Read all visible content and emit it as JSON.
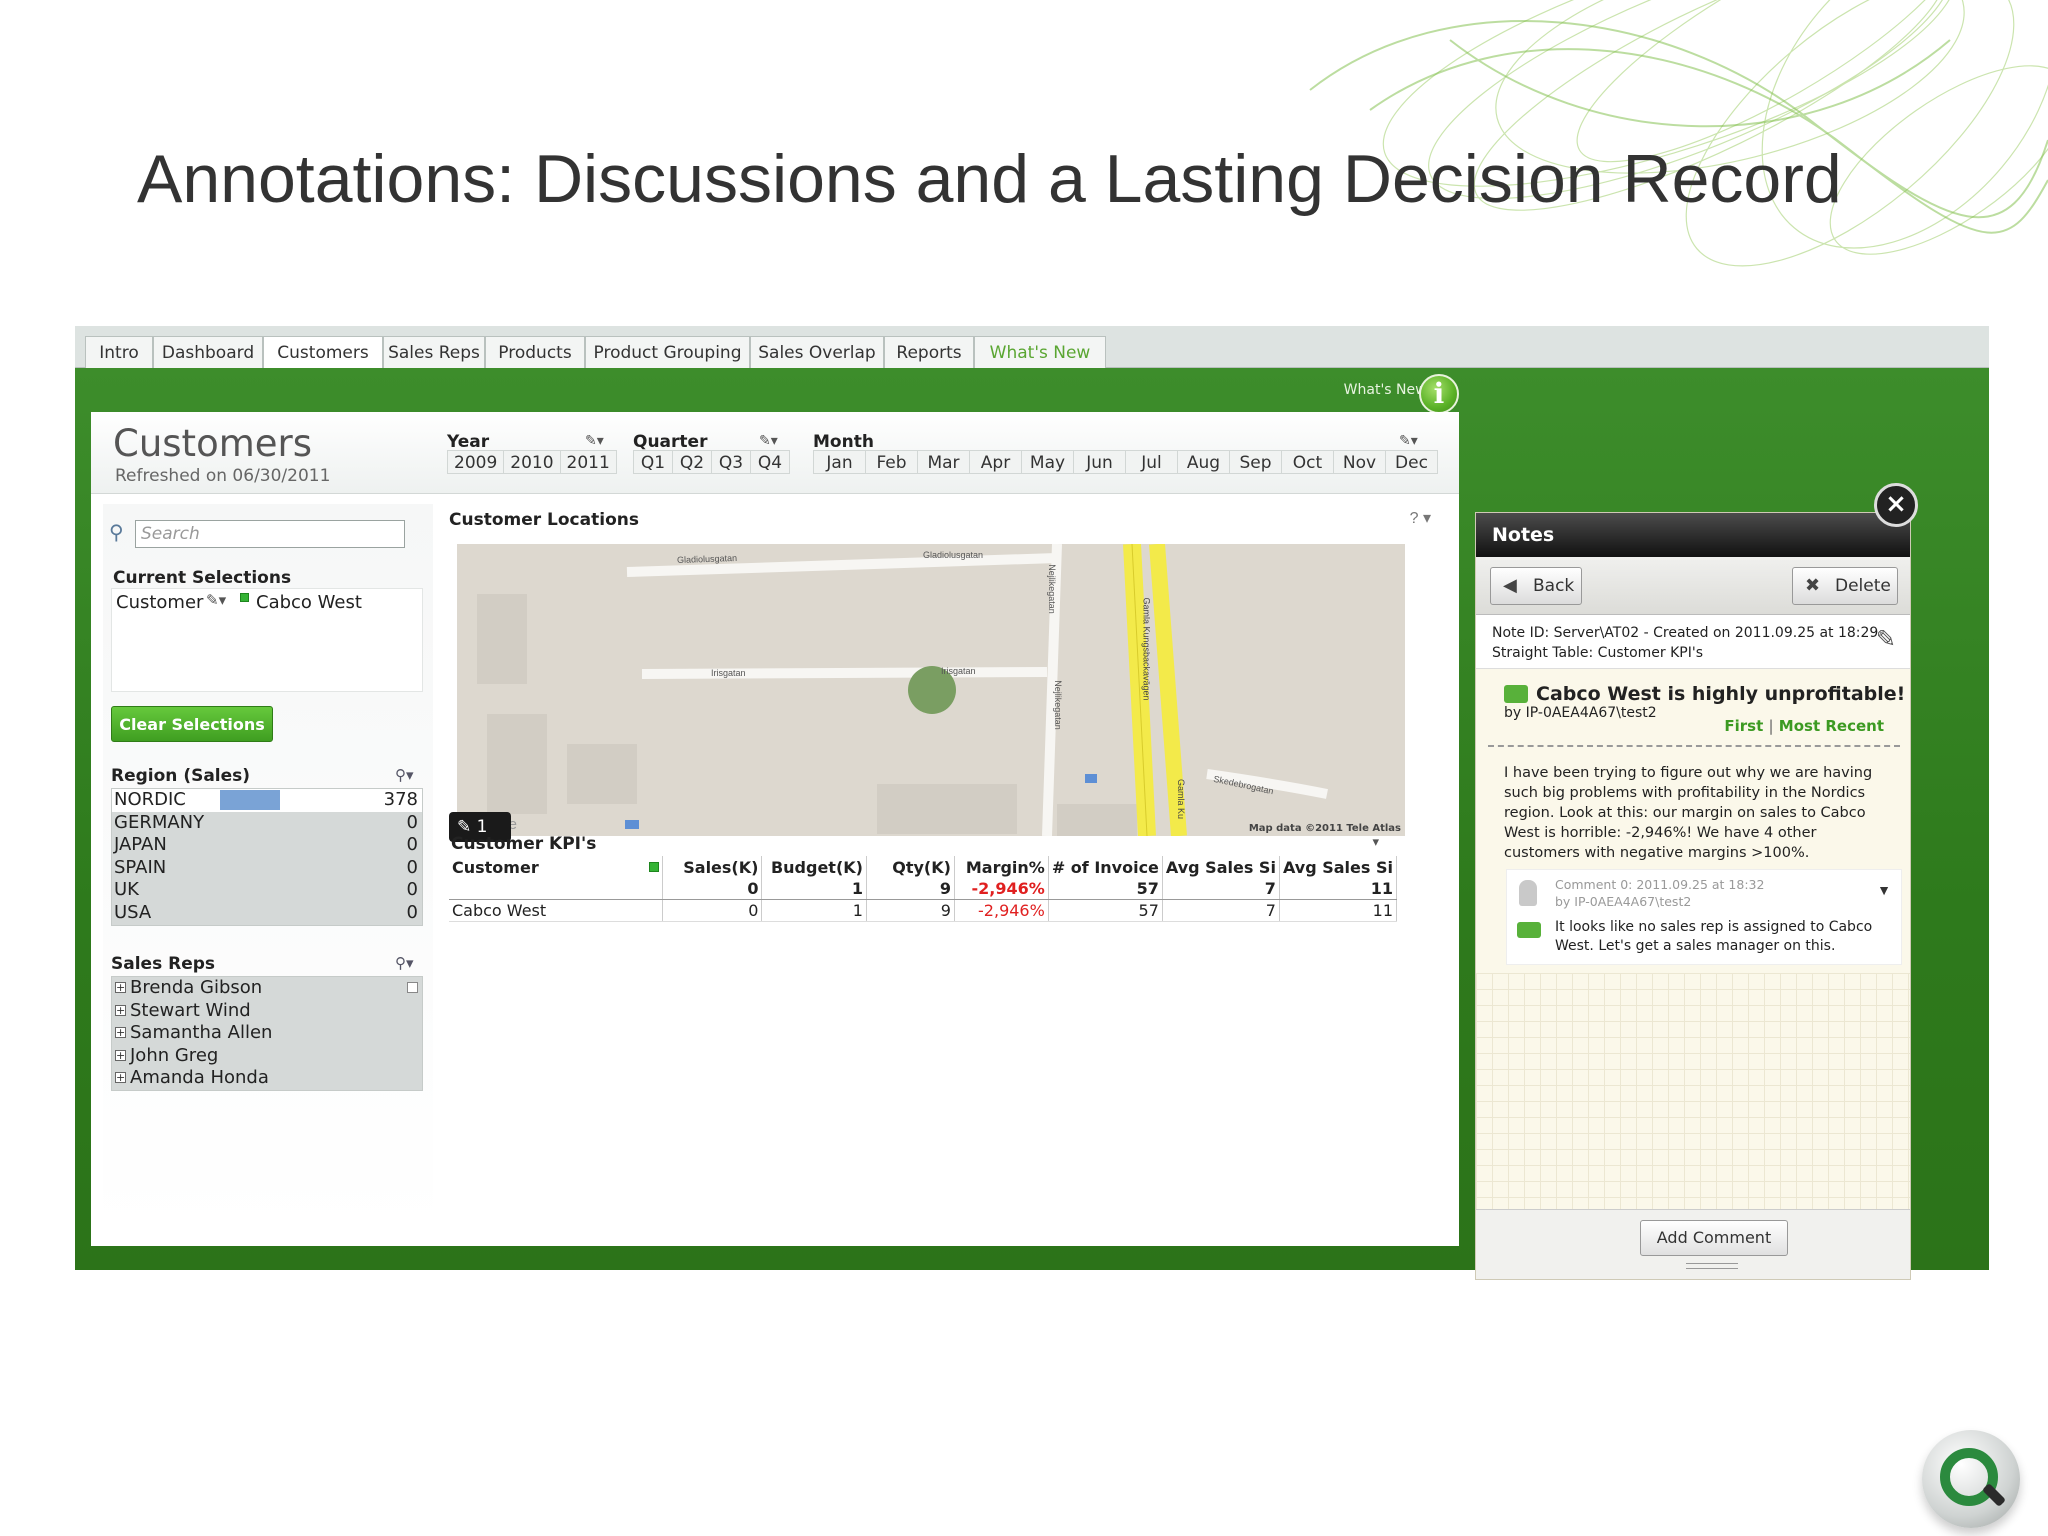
{
  "slide": {
    "title": "Annotations: Discussions and a Lasting Decision Record"
  },
  "tabs": [
    {
      "label": "Intro"
    },
    {
      "label": "Dashboard"
    },
    {
      "label": "Customers"
    },
    {
      "label": "Sales Reps"
    },
    {
      "label": "Products"
    },
    {
      "label": "Product Grouping"
    },
    {
      "label": "Sales Overlap"
    },
    {
      "label": "Reports"
    },
    {
      "label": "What's New"
    }
  ],
  "whats_new": {
    "label": "What's New?",
    "icon": "info-icon",
    "icon_glyph": "i"
  },
  "sheet": {
    "title": "Customers",
    "refreshed": "Refreshed on 06/30/2011"
  },
  "filters": {
    "year": {
      "label": "Year",
      "items": [
        "2009",
        "2010",
        "2011"
      ]
    },
    "quarter": {
      "label": "Quarter",
      "items": [
        "Q1",
        "Q2",
        "Q3",
        "Q4"
      ]
    },
    "month": {
      "label": "Month",
      "items": [
        "Jan",
        "Feb",
        "Mar",
        "Apr",
        "May",
        "Jun",
        "Jul",
        "Aug",
        "Sep",
        "Oct",
        "Nov",
        "Dec"
      ]
    }
  },
  "search": {
    "placeholder": "Search"
  },
  "current_selections": {
    "title": "Current Selections",
    "field": "Customer",
    "value": "Cabco West",
    "status_color": "#35b335"
  },
  "clear_button": "Clear Selections",
  "region": {
    "title": "Region (Sales)",
    "rows": [
      {
        "name": "NORDIC",
        "value": "378",
        "share": 0.28,
        "selected": true
      },
      {
        "name": "GERMANY",
        "value": "0",
        "share": 0,
        "selected": false
      },
      {
        "name": "JAPAN",
        "value": "0",
        "share": 0,
        "selected": false
      },
      {
        "name": "SPAIN",
        "value": "0",
        "share": 0,
        "selected": false
      },
      {
        "name": "UK",
        "value": "0",
        "share": 0,
        "selected": false
      },
      {
        "name": "USA",
        "value": "0",
        "share": 0,
        "selected": false
      }
    ]
  },
  "sales_reps": {
    "title": "Sales Reps",
    "rows": [
      "Brenda Gibson",
      "Stewart Wind",
      "Samantha Allen",
      "John Greg",
      "Amanda Honda"
    ]
  },
  "map": {
    "title": "Customer Locations",
    "streets": [
      "Gladiolusgatan",
      "Gladiolusgatan",
      "Irisgatan",
      "Irisgatan",
      "Gamla Kungsbackavägen",
      "Gamla Ku",
      "Skedebrogatan",
      "Nejlikegatan",
      "Nejlikegatan"
    ],
    "credit": "Map data ©2011 Tele Atlas",
    "watermark": "gle",
    "annotation_count": "1"
  },
  "kpi": {
    "title": "Customer KPI's",
    "columns": [
      "Customer",
      "Sales(K)",
      "Budget(K)",
      "Qty(K)",
      "Margin%",
      "# of Invoice",
      "Avg Sales Si",
      "Avg Sales Si"
    ],
    "total": [
      "",
      "0",
      "1",
      "9",
      "-2,946%",
      "57",
      "7",
      "11"
    ],
    "rows": [
      [
        "Cabco West",
        "0",
        "1",
        "9",
        "-2,946%",
        "57",
        "7",
        "11"
      ]
    ],
    "negative_color": "#e02020"
  },
  "notes": {
    "title": "Notes",
    "back": "Back",
    "delete": "Delete",
    "meta_line1": "Note ID: Server\\AT02 - Created on 2011.09.25 at 18:29",
    "meta_line2": "Straight Table: Customer KPI's",
    "subject": "Cabco West is highly unprofitable!",
    "by": "by IP-0AEA4A67\\test2",
    "nav_first": "First",
    "nav_sep": "|",
    "nav_recent": "Most Recent",
    "body": "I have been trying to figure out why we are having such big problems with profitability in the Nordics region. Look at this: our margin on sales to Cabco West is horrible: -2,946%! We have 4 other customers with negative margins >100%.",
    "comment_meta1": "Comment 0: 2011.09.25 at 18:32",
    "comment_meta2": "by IP-0AEA4A67\\test2",
    "comment_text": "It looks like no sales rep is assigned to Cabco West. Let's get a sales manager on this.",
    "add_comment": "Add Comment",
    "accent": "#3c9a22"
  }
}
